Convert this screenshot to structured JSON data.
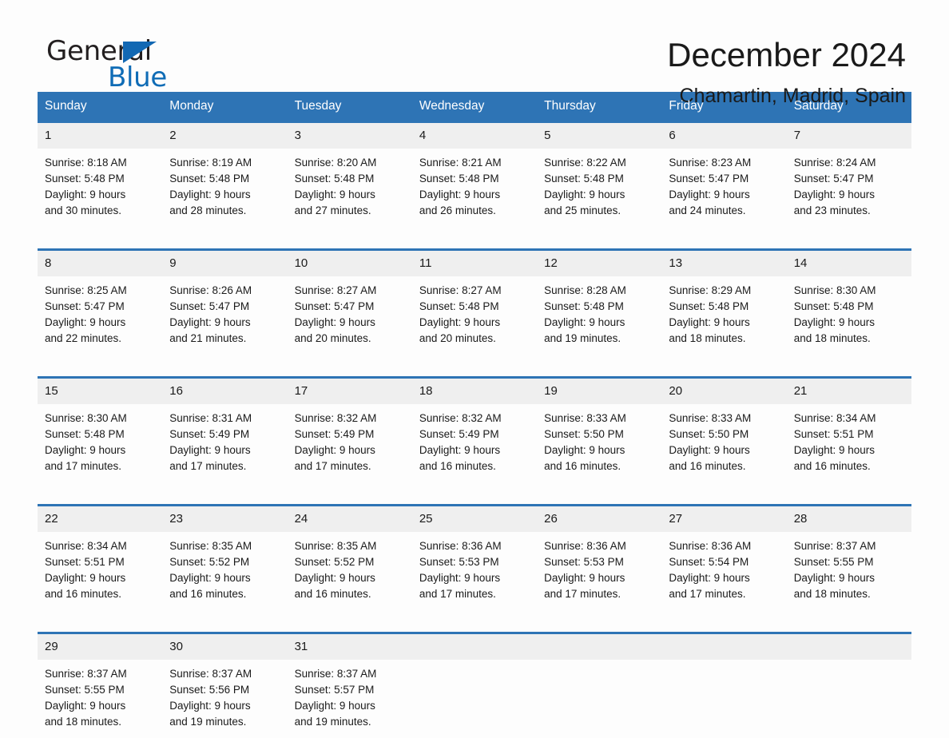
{
  "brand": {
    "name_part1": "General",
    "name_part2": "Blue"
  },
  "header": {
    "month_title": "December 2024",
    "location": "Chamartin, Madrid, Spain"
  },
  "colors": {
    "header_blue": "#2e74b5",
    "logo_blue": "#0f6cb6",
    "daynum_band": "#efefef",
    "page_bg": "#fdfdfd"
  },
  "weekdays": [
    "Sunday",
    "Monday",
    "Tuesday",
    "Wednesday",
    "Thursday",
    "Friday",
    "Saturday"
  ],
  "weeks": [
    [
      {
        "day": "1",
        "sunrise": "Sunrise: 8:18 AM",
        "sunset": "Sunset: 5:48 PM",
        "daylight1": "Daylight: 9 hours",
        "daylight2": "and 30 minutes."
      },
      {
        "day": "2",
        "sunrise": "Sunrise: 8:19 AM",
        "sunset": "Sunset: 5:48 PM",
        "daylight1": "Daylight: 9 hours",
        "daylight2": "and 28 minutes."
      },
      {
        "day": "3",
        "sunrise": "Sunrise: 8:20 AM",
        "sunset": "Sunset: 5:48 PM",
        "daylight1": "Daylight: 9 hours",
        "daylight2": "and 27 minutes."
      },
      {
        "day": "4",
        "sunrise": "Sunrise: 8:21 AM",
        "sunset": "Sunset: 5:48 PM",
        "daylight1": "Daylight: 9 hours",
        "daylight2": "and 26 minutes."
      },
      {
        "day": "5",
        "sunrise": "Sunrise: 8:22 AM",
        "sunset": "Sunset: 5:48 PM",
        "daylight1": "Daylight: 9 hours",
        "daylight2": "and 25 minutes."
      },
      {
        "day": "6",
        "sunrise": "Sunrise: 8:23 AM",
        "sunset": "Sunset: 5:47 PM",
        "daylight1": "Daylight: 9 hours",
        "daylight2": "and 24 minutes."
      },
      {
        "day": "7",
        "sunrise": "Sunrise: 8:24 AM",
        "sunset": "Sunset: 5:47 PM",
        "daylight1": "Daylight: 9 hours",
        "daylight2": "and 23 minutes."
      }
    ],
    [
      {
        "day": "8",
        "sunrise": "Sunrise: 8:25 AM",
        "sunset": "Sunset: 5:47 PM",
        "daylight1": "Daylight: 9 hours",
        "daylight2": "and 22 minutes."
      },
      {
        "day": "9",
        "sunrise": "Sunrise: 8:26 AM",
        "sunset": "Sunset: 5:47 PM",
        "daylight1": "Daylight: 9 hours",
        "daylight2": "and 21 minutes."
      },
      {
        "day": "10",
        "sunrise": "Sunrise: 8:27 AM",
        "sunset": "Sunset: 5:47 PM",
        "daylight1": "Daylight: 9 hours",
        "daylight2": "and 20 minutes."
      },
      {
        "day": "11",
        "sunrise": "Sunrise: 8:27 AM",
        "sunset": "Sunset: 5:48 PM",
        "daylight1": "Daylight: 9 hours",
        "daylight2": "and 20 minutes."
      },
      {
        "day": "12",
        "sunrise": "Sunrise: 8:28 AM",
        "sunset": "Sunset: 5:48 PM",
        "daylight1": "Daylight: 9 hours",
        "daylight2": "and 19 minutes."
      },
      {
        "day": "13",
        "sunrise": "Sunrise: 8:29 AM",
        "sunset": "Sunset: 5:48 PM",
        "daylight1": "Daylight: 9 hours",
        "daylight2": "and 18 minutes."
      },
      {
        "day": "14",
        "sunrise": "Sunrise: 8:30 AM",
        "sunset": "Sunset: 5:48 PM",
        "daylight1": "Daylight: 9 hours",
        "daylight2": "and 18 minutes."
      }
    ],
    [
      {
        "day": "15",
        "sunrise": "Sunrise: 8:30 AM",
        "sunset": "Sunset: 5:48 PM",
        "daylight1": "Daylight: 9 hours",
        "daylight2": "and 17 minutes."
      },
      {
        "day": "16",
        "sunrise": "Sunrise: 8:31 AM",
        "sunset": "Sunset: 5:49 PM",
        "daylight1": "Daylight: 9 hours",
        "daylight2": "and 17 minutes."
      },
      {
        "day": "17",
        "sunrise": "Sunrise: 8:32 AM",
        "sunset": "Sunset: 5:49 PM",
        "daylight1": "Daylight: 9 hours",
        "daylight2": "and 17 minutes."
      },
      {
        "day": "18",
        "sunrise": "Sunrise: 8:32 AM",
        "sunset": "Sunset: 5:49 PM",
        "daylight1": "Daylight: 9 hours",
        "daylight2": "and 16 minutes."
      },
      {
        "day": "19",
        "sunrise": "Sunrise: 8:33 AM",
        "sunset": "Sunset: 5:50 PM",
        "daylight1": "Daylight: 9 hours",
        "daylight2": "and 16 minutes."
      },
      {
        "day": "20",
        "sunrise": "Sunrise: 8:33 AM",
        "sunset": "Sunset: 5:50 PM",
        "daylight1": "Daylight: 9 hours",
        "daylight2": "and 16 minutes."
      },
      {
        "day": "21",
        "sunrise": "Sunrise: 8:34 AM",
        "sunset": "Sunset: 5:51 PM",
        "daylight1": "Daylight: 9 hours",
        "daylight2": "and 16 minutes."
      }
    ],
    [
      {
        "day": "22",
        "sunrise": "Sunrise: 8:34 AM",
        "sunset": "Sunset: 5:51 PM",
        "daylight1": "Daylight: 9 hours",
        "daylight2": "and 16 minutes."
      },
      {
        "day": "23",
        "sunrise": "Sunrise: 8:35 AM",
        "sunset": "Sunset: 5:52 PM",
        "daylight1": "Daylight: 9 hours",
        "daylight2": "and 16 minutes."
      },
      {
        "day": "24",
        "sunrise": "Sunrise: 8:35 AM",
        "sunset": "Sunset: 5:52 PM",
        "daylight1": "Daylight: 9 hours",
        "daylight2": "and 16 minutes."
      },
      {
        "day": "25",
        "sunrise": "Sunrise: 8:36 AM",
        "sunset": "Sunset: 5:53 PM",
        "daylight1": "Daylight: 9 hours",
        "daylight2": "and 17 minutes."
      },
      {
        "day": "26",
        "sunrise": "Sunrise: 8:36 AM",
        "sunset": "Sunset: 5:53 PM",
        "daylight1": "Daylight: 9 hours",
        "daylight2": "and 17 minutes."
      },
      {
        "day": "27",
        "sunrise": "Sunrise: 8:36 AM",
        "sunset": "Sunset: 5:54 PM",
        "daylight1": "Daylight: 9 hours",
        "daylight2": "and 17 minutes."
      },
      {
        "day": "28",
        "sunrise": "Sunrise: 8:37 AM",
        "sunset": "Sunset: 5:55 PM",
        "daylight1": "Daylight: 9 hours",
        "daylight2": "and 18 minutes."
      }
    ],
    [
      {
        "day": "29",
        "sunrise": "Sunrise: 8:37 AM",
        "sunset": "Sunset: 5:55 PM",
        "daylight1": "Daylight: 9 hours",
        "daylight2": "and 18 minutes."
      },
      {
        "day": "30",
        "sunrise": "Sunrise: 8:37 AM",
        "sunset": "Sunset: 5:56 PM",
        "daylight1": "Daylight: 9 hours",
        "daylight2": "and 19 minutes."
      },
      {
        "day": "31",
        "sunrise": "Sunrise: 8:37 AM",
        "sunset": "Sunset: 5:57 PM",
        "daylight1": "Daylight: 9 hours",
        "daylight2": "and 19 minutes."
      },
      {
        "day": "",
        "sunrise": "",
        "sunset": "",
        "daylight1": "",
        "daylight2": ""
      },
      {
        "day": "",
        "sunrise": "",
        "sunset": "",
        "daylight1": "",
        "daylight2": ""
      },
      {
        "day": "",
        "sunrise": "",
        "sunset": "",
        "daylight1": "",
        "daylight2": ""
      },
      {
        "day": "",
        "sunrise": "",
        "sunset": "",
        "daylight1": "",
        "daylight2": ""
      }
    ]
  ]
}
